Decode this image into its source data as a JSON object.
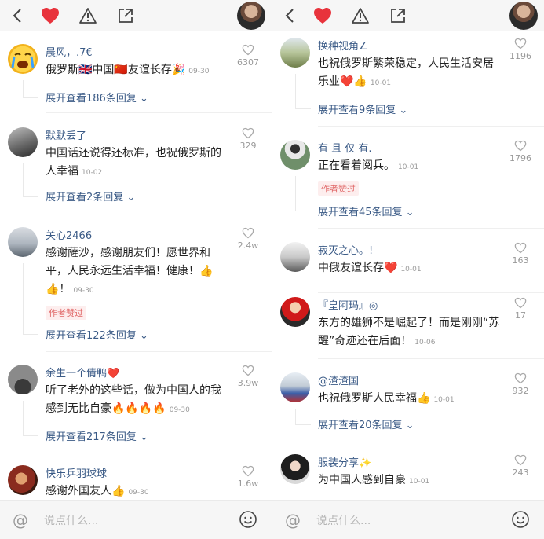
{
  "input": {
    "placeholder": "说点什么..."
  },
  "left": {
    "comments": [
      {
        "name": "晨风，.7€",
        "text": "俄罗斯🇬🇧中国🇨🇳友谊长存🎉",
        "time": "09-30",
        "likes": "6307",
        "expand": "展开查看186条回复"
      },
      {
        "name": "默默丢了",
        "text": "中国话还说得还标准，也祝俄罗斯的人幸福",
        "time": "10-02",
        "likes": "329",
        "expand": "展开查看2条回复"
      },
      {
        "name": "关心2466",
        "text": "感谢薩沙，感谢朋友们！愿世界和平，人民永远生活幸福！健康！👍👍！",
        "time": "09-30",
        "likes": "2.4w",
        "badge": "作者赞过",
        "expand": "展开查看122条回复"
      },
      {
        "name": "余生一个倩鸭❤️",
        "text": "听了老外的这些话，做为中国人的我感到无比自豪🔥🔥🔥🔥",
        "time": "09-30",
        "likes": "3.9w",
        "expand": "展开查看217条回复"
      },
      {
        "name": "快乐乒羽球球",
        "text": "感谢外国友人👍",
        "time": "09-30",
        "likes": "1.6w"
      }
    ]
  },
  "right": {
    "comments": [
      {
        "name": "换种视角∠",
        "text": "也祝俄罗斯繁荣稳定，人民生活安居乐业❤️👍",
        "time": "10-01",
        "likes": "1196",
        "expand": "展开查看9条回复"
      },
      {
        "name": "有 且 仅 有.",
        "text": "正在看着阅兵。",
        "time": "10-01",
        "likes": "1796",
        "badge": "作者赞过",
        "expand": "展开查看45条回复"
      },
      {
        "name": "寂灭之心。!",
        "text": "中俄友谊长存❤️",
        "time": "10-01",
        "likes": "163"
      },
      {
        "name": "『皇阿玛』◎",
        "text": "东方的雄狮不是崛起了！而是刚刚“苏醒”奇迹还在后面！",
        "time": "10-06",
        "likes": "17"
      },
      {
        "name": "@渣渣国",
        "text": "也祝俄罗斯人民幸福👍",
        "time": "10-01",
        "likes": "932",
        "expand": "展开查看20条回复"
      },
      {
        "name": "服装分享✨",
        "text": "为中国人感到自豪",
        "time": "10-01",
        "likes": "243"
      }
    ]
  },
  "icons": {
    "back": "chevron-left-icon",
    "favorite": "heart-icon",
    "report": "warning-icon",
    "share": "share-icon",
    "mention": "at-icon",
    "emoji": "smiley-icon",
    "like": "heart-outline-icon"
  },
  "colors": {
    "accent_link": "#3a5a86",
    "heart_red": "#e8333c",
    "badge_red": "#e06666"
  }
}
